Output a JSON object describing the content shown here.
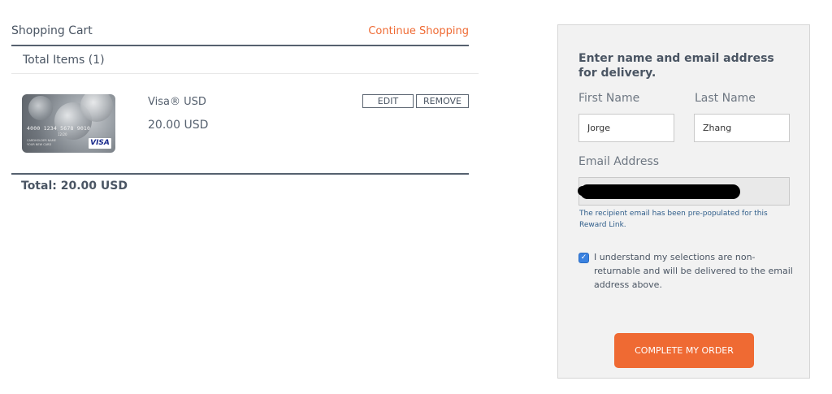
{
  "cart": {
    "title": "Shopping Cart",
    "continue_label": "Continue Shopping",
    "total_items_label": "Total Items (1)",
    "items": [
      {
        "name": "Visa® USD",
        "price": "20.00 USD",
        "edit_label": "EDIT",
        "remove_label": "REMOVE",
        "card": {
          "number": "4000 1234 5678 9010",
          "expiry": "12/20",
          "holder_line1": "CARDHOLDER NAME",
          "holder_line2": "YOUR NEW CARD",
          "brand": "VISA"
        }
      }
    ],
    "total_label": "Total: 20.00 USD"
  },
  "delivery": {
    "heading": "Enter name and email address for delivery.",
    "first_name_label": "First Name",
    "last_name_label": "Last Name",
    "first_name_value": "Jorge",
    "last_name_value": "Zhang",
    "email_label": "Email Address",
    "email_value": "",
    "helper_text": "The recipient email has been pre-populated for this Reward Link.",
    "acknowledgement": "I understand my selections are non-returnable and will be delivered to the email address above.",
    "acknowledgement_checked": true,
    "submit_label": "COMPLETE MY ORDER"
  },
  "colors": {
    "accent": "#ef6a33",
    "text": "#4a5563",
    "link_blue": "#2f5d8a",
    "checkbox_blue": "#3b82e0",
    "panel_bg": "#f2f2f2"
  },
  "icons": {
    "checkbox": "checkmark-icon"
  }
}
